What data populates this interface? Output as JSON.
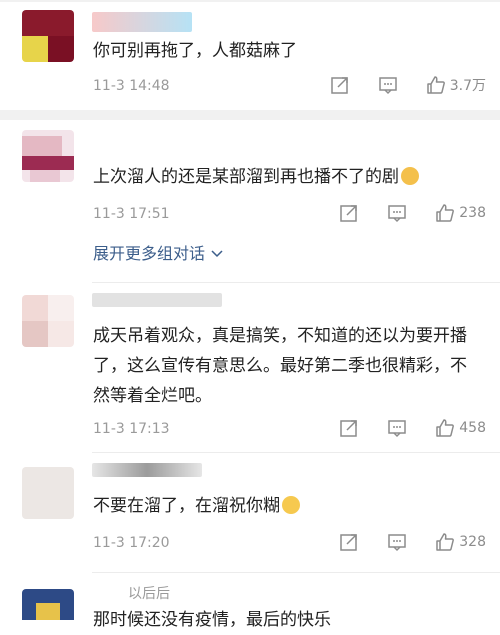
{
  "comments": [
    {
      "text": "你可别再拖了，人都菇麻了",
      "time": "11-3 14:48",
      "likes": "3.7万",
      "avatar_colors": [
        "#d9a090",
        "#7a1024",
        "#e7d44a"
      ],
      "name_color": "#b6e2f5"
    },
    {
      "text": "上次溜人的还是某部溜到再也播不了的剧",
      "time": "11-3 17:51",
      "likes": "238",
      "expand_label": "展开更多组对话",
      "avatar_colors": [
        "#e4b8c3",
        "#9c2b52",
        "#f3e4ea"
      ],
      "name_color": "#e6e6e6"
    },
    {
      "text": "成天吊着观众，真是搞笑，不知道的还以为要开播了，这么宣传有意思么。最好第二季也很精彩，不然等着全烂吧。",
      "time": "11-3 17:13",
      "likes": "458",
      "avatar_colors": [
        "#f1d9d6",
        "#e5c7c4",
        "#f8efee"
      ],
      "name_color": "#d8d8d8"
    },
    {
      "text": "不要在溜了，在溜祝你糊",
      "time": "11-3 17:20",
      "likes": "328",
      "avatar_colors": [
        "#ece7e4",
        "#e9e3df",
        "#f3efec"
      ],
      "name_color": "#c8c8c8"
    },
    {
      "name_partial": "以后后",
      "text": "那时候还没有疫情，最后的快乐",
      "avatar_colors": [
        "#2d4a86",
        "#1f3a78",
        "#e7c24a"
      ]
    }
  ],
  "icons": {
    "share": "share-icon",
    "comment": "comment-icon",
    "like": "thumbs-up-icon",
    "expand": "chevron-down-icon"
  },
  "colors": {
    "link": "#3c5e8b",
    "meta": "#9a9a9a",
    "icon": "#8c8c8c",
    "separator": "#f1f1f1"
  }
}
